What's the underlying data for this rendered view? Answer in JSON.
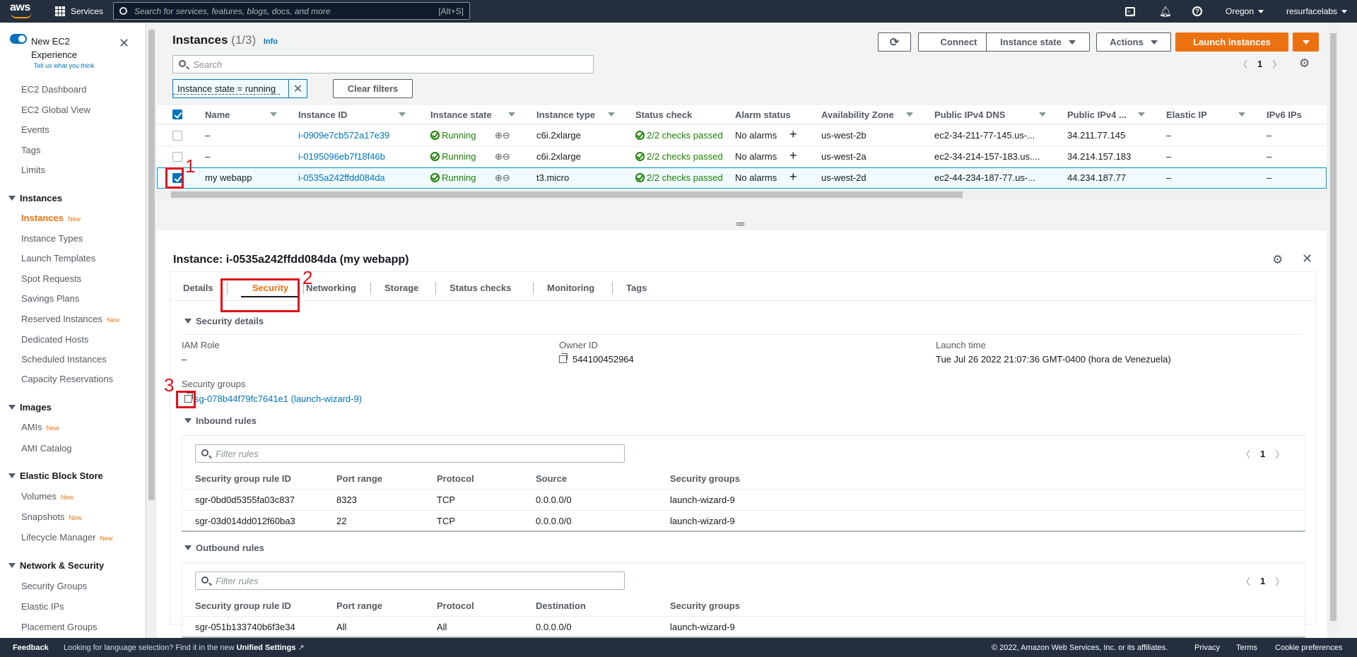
{
  "topnav": {
    "logo": "aws",
    "services": "Services",
    "search_placeholder": "Search for services, features, blogs, docs, and more",
    "search_shortcut": "[Alt+S]",
    "region": "Oregon",
    "account": "resurfacelabs",
    "icons": [
      "cloudshell-icon",
      "bell-icon",
      "help-icon"
    ]
  },
  "sidebar": {
    "new_exp_line1": "New EC2",
    "new_exp_line2": "Experience",
    "feedback": "Tell us what you think",
    "items_top": [
      "EC2 Dashboard",
      "EC2 Global View",
      "Events",
      "Tags",
      "Limits"
    ],
    "instances_head": "Instances",
    "instances_items": [
      "Instances",
      "Instance Types",
      "Launch Templates",
      "Spot Requests",
      "Savings Plans",
      "Reserved Instances",
      "Dedicated Hosts",
      "Scheduled Instances",
      "Capacity Reservations"
    ],
    "images_head": "Images",
    "images_items": [
      "AMIs",
      "AMI Catalog"
    ],
    "ebs_head": "Elastic Block Store",
    "ebs_items": [
      "Volumes",
      "Snapshots",
      "Lifecycle Manager"
    ],
    "net_head": "Network & Security",
    "net_items": [
      "Security Groups",
      "Elastic IPs",
      "Placement Groups"
    ],
    "new_badge": "New"
  },
  "header": {
    "title": "Instances",
    "count": "(1/3)",
    "info": "Info",
    "connect": "Connect",
    "instance_state": "Instance state",
    "actions": "Actions",
    "launch": "Launch instances",
    "search_placeholder": "Search",
    "filter_chip": "Instance state = running",
    "clear_filters": "Clear filters",
    "page": "1"
  },
  "table": {
    "columns": [
      "Name",
      "Instance ID",
      "Instance state",
      "Instance type",
      "Status check",
      "Alarm status",
      "Availability Zone",
      "Public IPv4 DNS",
      "Public IPv4 ...",
      "Elastic IP",
      "IPv6 IPs"
    ],
    "rows": [
      {
        "name": "–",
        "id": "i-0909e7cb572a17e39",
        "state": "Running",
        "type": "c6i.2xlarge",
        "status": "2/2 checks passed",
        "alarm": "No alarms",
        "az": "us-west-2b",
        "dns": "ec2-34-211-77-145.us-...",
        "ip": "34.211.77.145",
        "eip": "–",
        "ipv6": "–"
      },
      {
        "name": "–",
        "id": "i-0195096eb7f18f46b",
        "state": "Running",
        "type": "c6i.2xlarge",
        "status": "2/2 checks passed",
        "alarm": "No alarms",
        "az": "us-west-2a",
        "dns": "ec2-34-214-157-183.us....",
        "ip": "34.214.157.183",
        "eip": "–",
        "ipv6": "–"
      },
      {
        "name": "my webapp",
        "id": "i-0535a242ffdd084da",
        "state": "Running",
        "type": "t3.micro",
        "status": "2/2 checks passed",
        "alarm": "No alarms",
        "az": "us-west-2d",
        "dns": "ec2-44-234-187-77.us-...",
        "ip": "44.234.187.77",
        "eip": "–",
        "ipv6": "–"
      }
    ]
  },
  "annotations": [
    "1",
    "2",
    "3"
  ],
  "detail": {
    "title": "Instance: i-0535a242ffdd084da (my webapp)",
    "tabs": [
      "Details",
      "Security",
      "Networking",
      "Storage",
      "Status checks",
      "Monitoring",
      "Tags"
    ],
    "security_details": "Security details",
    "iam_role_label": "IAM Role",
    "iam_role_value": "–",
    "owner_label": "Owner ID",
    "owner_value": "544100452964",
    "launch_label": "Launch time",
    "launch_value": "Tue Jul 26 2022 21:07:36 GMT-0400 (hora de Venezuela)",
    "sg_label": "Security groups",
    "sg_value": "sg-078b44f79fc7641e1 (launch-wizard-9)",
    "inbound_head": "Inbound rules",
    "outbound_head": "Outbound rules",
    "filter_placeholder": "Filter rules",
    "page": "1",
    "inbound_columns": [
      "Security group rule ID",
      "Port range",
      "Protocol",
      "Source",
      "Security groups"
    ],
    "inbound_rows": [
      [
        "sgr-0bd0d5355fa03c837",
        "8323",
        "TCP",
        "0.0.0.0/0",
        "launch-wizard-9"
      ],
      [
        "sgr-03d014dd012f60ba3",
        "22",
        "TCP",
        "0.0.0.0/0",
        "launch-wizard-9"
      ]
    ],
    "outbound_columns": [
      "Security group rule ID",
      "Port range",
      "Protocol",
      "Destination",
      "Security groups"
    ],
    "outbound_rows": [
      [
        "sgr-051b133740b6f3e34",
        "All",
        "All",
        "0.0.0.0/0",
        "launch-wizard-9"
      ]
    ]
  },
  "footer": {
    "feedback": "Feedback",
    "lang_text": "Looking for language selection? Find it in the new",
    "unified": "Unified Settings",
    "copyright": "© 2022, Amazon Web Services, Inc. or its affiliates.",
    "privacy": "Privacy",
    "terms": "Terms",
    "cookies": "Cookie preferences"
  }
}
